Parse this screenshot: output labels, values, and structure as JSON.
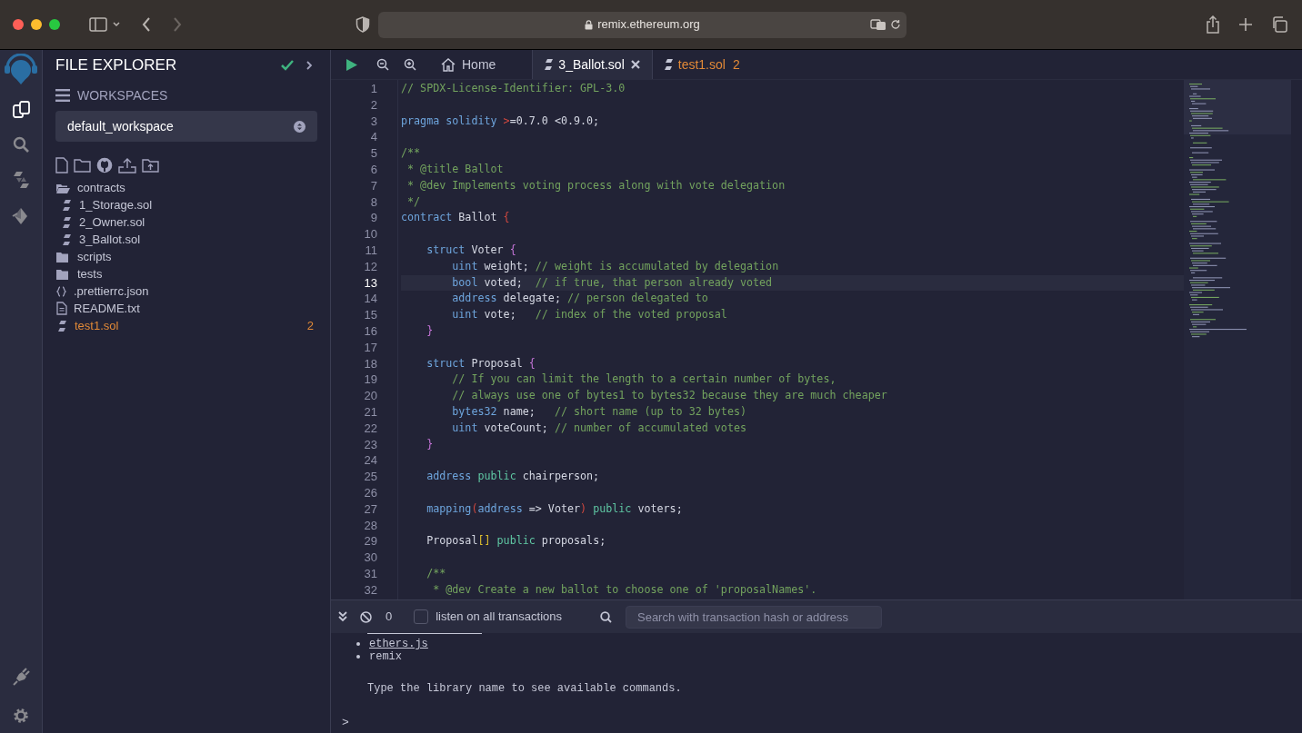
{
  "browser": {
    "url": "remix.ethereum.org"
  },
  "icon_panel": [
    {
      "kind": "files",
      "selected": true
    },
    {
      "kind": "search",
      "selected": false
    },
    {
      "kind": "compiler",
      "selected": false
    },
    {
      "kind": "deploy",
      "selected": false
    }
  ],
  "side_panel": {
    "title": "FILE EXPLORER",
    "workspaces_label": "WORKSPACES",
    "workspace": "default_workspace",
    "tree": [
      {
        "kind": "folder",
        "name": "contracts",
        "expanded": true,
        "warning": false,
        "children": [
          {
            "kind": "sol",
            "name": "1_Storage.sol",
            "warning": false
          },
          {
            "kind": "sol",
            "name": "2_Owner.sol",
            "warning": false
          },
          {
            "kind": "sol",
            "name": "3_Ballot.sol",
            "warning": false
          }
        ]
      },
      {
        "kind": "folder",
        "name": "scripts",
        "expanded": false,
        "warning": false
      },
      {
        "kind": "folder",
        "name": "tests",
        "expanded": false,
        "warning": false
      },
      {
        "kind": "json",
        "name": ".prettierrc.json",
        "warning": false
      },
      {
        "kind": "txt",
        "name": "README.txt",
        "warning": false
      },
      {
        "kind": "sol",
        "name": "test1.sol",
        "warning": true,
        "badge": "2"
      }
    ]
  },
  "tabs": [
    {
      "kind": "home",
      "label": "Home",
      "selected": false,
      "warning": false
    },
    {
      "kind": "sol",
      "label": "3_Ballot.sol",
      "selected": true,
      "warning": false
    },
    {
      "kind": "sol",
      "label": "test1.sol",
      "selected": false,
      "warning": true,
      "badge": "2"
    }
  ],
  "code": [
    {
      "number": "1",
      "current": false,
      "tokens": [
        {
          "kind": "comment",
          "text": "// SPDX-License-Identifier: GPL-3.0"
        }
      ]
    },
    {
      "number": "2",
      "current": false
    },
    {
      "number": "3",
      "current": false,
      "tokens": [
        {
          "kind": "keyword",
          "text": "pragma solidity "
        },
        {
          "kind": "red",
          "text": ">"
        },
        {
          "kind": "plain",
          "text": "=0.7.0 <0.9.0;"
        }
      ]
    },
    {
      "number": "4",
      "current": false
    },
    {
      "number": "5",
      "current": false,
      "tokens": [
        {
          "kind": "comment",
          "text": "/**"
        }
      ]
    },
    {
      "number": "6",
      "current": false,
      "tokens": [
        {
          "kind": "comment",
          "text": " * @title Ballot"
        }
      ]
    },
    {
      "number": "7",
      "current": false,
      "tokens": [
        {
          "kind": "comment",
          "text": " * @dev Implements voting process along with vote delegation"
        }
      ]
    },
    {
      "number": "8",
      "current": false,
      "tokens": [
        {
          "kind": "comment",
          "text": " */"
        }
      ]
    },
    {
      "number": "9",
      "current": false,
      "tokens": [
        {
          "kind": "keyword",
          "text": "contract"
        },
        {
          "kind": "plain",
          "text": " Ballot "
        },
        {
          "kind": "red",
          "text": "{"
        }
      ]
    },
    {
      "number": "10",
      "current": false
    },
    {
      "number": "11",
      "current": false,
      "tokens": [
        {
          "kind": "keyword",
          "text": "    struct"
        },
        {
          "kind": "plain",
          "text": " Voter "
        },
        {
          "kind": "pink",
          "text": "{"
        }
      ]
    },
    {
      "number": "12",
      "current": false,
      "tokens": [
        {
          "kind": "keyword",
          "text": "        uint"
        },
        {
          "kind": "plain",
          "text": " weight; "
        },
        {
          "kind": "comment",
          "text": "// weight is accumulated by delegation"
        }
      ]
    },
    {
      "number": "13",
      "current": true,
      "tokens": [
        {
          "kind": "keyword",
          "text": "        bool"
        },
        {
          "kind": "plain",
          "text": " voted;  "
        },
        {
          "kind": "comment",
          "text": "// if true, that person already voted"
        }
      ]
    },
    {
      "number": "14",
      "current": false,
      "tokens": [
        {
          "kind": "keyword",
          "text": "        address"
        },
        {
          "kind": "plain",
          "text": " delegate; "
        },
        {
          "kind": "comment",
          "text": "// person delegated to"
        }
      ]
    },
    {
      "number": "15",
      "current": false,
      "tokens": [
        {
          "kind": "keyword",
          "text": "        uint"
        },
        {
          "kind": "plain",
          "text": " vote;   "
        },
        {
          "kind": "comment",
          "text": "// index of the voted proposal"
        }
      ]
    },
    {
      "number": "16",
      "current": false,
      "tokens": [
        {
          "kind": "pink",
          "text": "    }"
        }
      ]
    },
    {
      "number": "17",
      "current": false
    },
    {
      "number": "18",
      "current": false,
      "tokens": [
        {
          "kind": "keyword",
          "text": "    struct"
        },
        {
          "kind": "plain",
          "text": " Proposal "
        },
        {
          "kind": "pink",
          "text": "{"
        }
      ]
    },
    {
      "number": "19",
      "current": false,
      "tokens": [
        {
          "kind": "comment",
          "text": "        // If you can limit the length to a certain number of bytes,"
        }
      ]
    },
    {
      "number": "20",
      "current": false,
      "tokens": [
        {
          "kind": "comment",
          "text": "        // always use one of bytes1 to bytes32 because they are much cheaper"
        }
      ]
    },
    {
      "number": "21",
      "current": false,
      "tokens": [
        {
          "kind": "keyword",
          "text": "        bytes32"
        },
        {
          "kind": "plain",
          "text": " name;   "
        },
        {
          "kind": "comment",
          "text": "// short name (up to 32 bytes)"
        }
      ]
    },
    {
      "number": "22",
      "current": false,
      "tokens": [
        {
          "kind": "keyword",
          "text": "        uint"
        },
        {
          "kind": "plain",
          "text": " voteCount; "
        },
        {
          "kind": "comment",
          "text": "// number of accumulated votes"
        }
      ]
    },
    {
      "number": "23",
      "current": false,
      "tokens": [
        {
          "kind": "pink",
          "text": "    }"
        }
      ]
    },
    {
      "number": "24",
      "current": false
    },
    {
      "number": "25",
      "current": false,
      "tokens": [
        {
          "kind": "keyword",
          "text": "    address"
        },
        {
          "kind": "modifier",
          "text": " public"
        },
        {
          "kind": "plain",
          "text": " chairperson;"
        }
      ]
    },
    {
      "number": "26",
      "current": false
    },
    {
      "number": "27",
      "current": false,
      "tokens": [
        {
          "kind": "keyword",
          "text": "    mapping"
        },
        {
          "kind": "red",
          "text": "("
        },
        {
          "kind": "keyword",
          "text": "address"
        },
        {
          "kind": "plain",
          "text": " => Voter"
        },
        {
          "kind": "red",
          "text": ")"
        },
        {
          "kind": "modifier",
          "text": " public"
        },
        {
          "kind": "plain",
          "text": " voters;"
        }
      ]
    },
    {
      "number": "28",
      "current": false
    },
    {
      "number": "29",
      "current": false,
      "tokens": [
        {
          "kind": "plain",
          "text": "    Proposal"
        },
        {
          "kind": "yellow",
          "text": "[]"
        },
        {
          "kind": "modifier",
          "text": " public"
        },
        {
          "kind": "plain",
          "text": " proposals;"
        }
      ]
    },
    {
      "number": "30",
      "current": false
    },
    {
      "number": "31",
      "current": false,
      "tokens": [
        {
          "kind": "comment",
          "text": "    /**"
        }
      ]
    },
    {
      "number": "32",
      "current": false,
      "tokens": [
        {
          "kind": "comment",
          "text": "     * @dev Create a new ballot to choose one of 'proposalNames'."
        }
      ]
    }
  ],
  "terminal": {
    "count": "0",
    "listen_label": "listen on all transactions",
    "listen_checked": false,
    "search_placeholder": "Search with transaction hash or address",
    "lines": [
      {
        "kind": "link-bullet",
        "text": "ethers.js"
      },
      {
        "kind": "bullet",
        "text": "remix"
      },
      {
        "kind": "message",
        "text": "Type the library name to see available commands."
      }
    ],
    "prompt": ">"
  }
}
